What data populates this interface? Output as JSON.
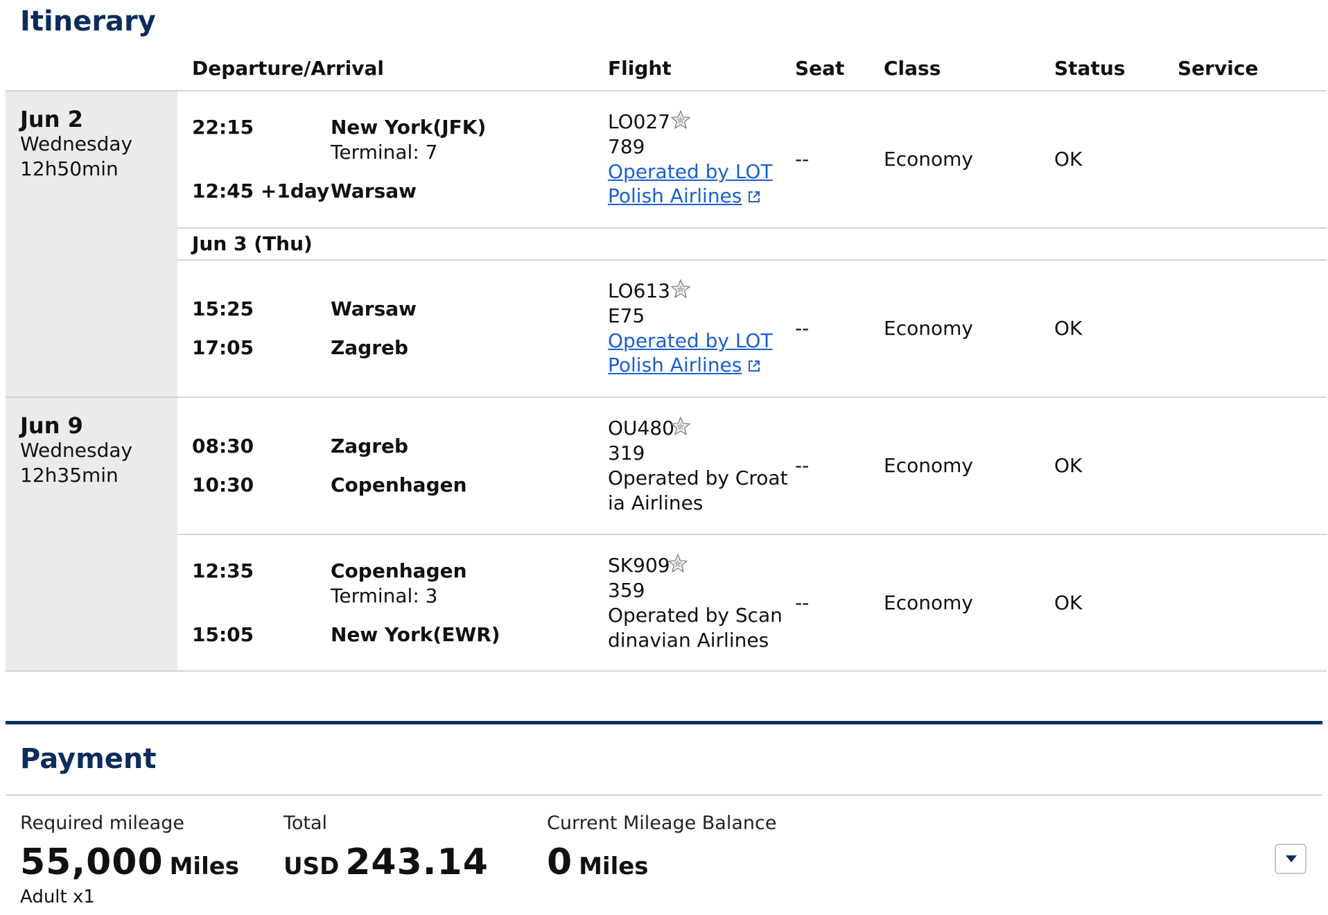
{
  "itinerary": {
    "title": "Itinerary",
    "columns": {
      "departure_arrival": "Departure/Arrival",
      "flight": "Flight",
      "seat": "Seat",
      "class": "Class",
      "status": "Status",
      "service": "Service"
    },
    "days": [
      {
        "date": "Jun 2",
        "weekday": "Wednesday",
        "duration": "12h50min"
      },
      {
        "date": "Jun 9",
        "weekday": "Wednesday",
        "duration": "12h35min"
      }
    ],
    "connection_date": "Jun 3 (Thu)",
    "segments": [
      {
        "dep_time": "22:15",
        "dep_city": "New York(JFK)",
        "dep_terminal": "Terminal: 7",
        "arr_time": "12:45 +1day",
        "arr_city": "Warsaw",
        "flight_no": "LO027",
        "aircraft": "789",
        "operated_line1": "Operated by LOT ",
        "operated_line2": "Polish Airlines",
        "seat": "--",
        "class": "Economy",
        "status": "OK"
      },
      {
        "dep_time": "15:25",
        "dep_city": "Warsaw",
        "arr_time": "17:05",
        "arr_city": "Zagreb",
        "flight_no": "LO613",
        "aircraft": "E75",
        "operated_line1": "Operated by LOT ",
        "operated_line2": "Polish Airlines",
        "seat": "--",
        "class": "Economy",
        "status": "OK"
      },
      {
        "dep_time": "08:30",
        "dep_city": "Zagreb",
        "arr_time": "10:30",
        "arr_city": "Copenhagen",
        "flight_no": "OU480",
        "aircraft": "319",
        "operated_line1": "Operated by Croat",
        "operated_line2": "ia Airlines",
        "seat": "--",
        "class": "Economy",
        "status": "OK"
      },
      {
        "dep_time": "12:35",
        "dep_city": "Copenhagen",
        "dep_terminal": "Terminal: 3",
        "arr_time": "15:05",
        "arr_city": "New York(EWR)",
        "flight_no": "SK909",
        "aircraft": "359",
        "operated_line1": "Operated by Scan",
        "operated_line2": "dinavian Airlines",
        "seat": "--",
        "class": "Economy",
        "status": "OK"
      }
    ]
  },
  "payment": {
    "title": "Payment",
    "required_mileage_label": "Required mileage",
    "required_mileage_value": "55,000",
    "required_mileage_unit": "Miles",
    "passengers": "Adult x1",
    "total_label": "Total",
    "total_currency": "USD",
    "total_amount": "243.14",
    "balance_label": "Current Mileage Balance",
    "balance_value": "0",
    "balance_unit": "Miles"
  },
  "icons": {
    "alliance": "star-alliance-icon",
    "external": "external-link-icon",
    "dropdown": "chevron-down-icon"
  },
  "colors": {
    "heading": "#0b2d5b",
    "link": "#1a5fd0",
    "date_column_bg": "#ebebeb",
    "divider": "#d4d4d4"
  }
}
